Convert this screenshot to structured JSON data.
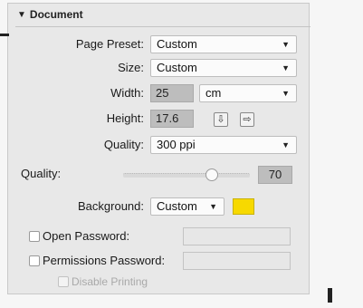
{
  "document": {
    "section_title": "Document",
    "page_preset": {
      "label": "Page Preset:",
      "value": "Custom"
    },
    "size": {
      "label": "Size:",
      "value": "Custom"
    },
    "width": {
      "label": "Width:",
      "value": "25",
      "unit": "cm"
    },
    "height": {
      "label": "Height:",
      "value": "17.6"
    },
    "quality_select": {
      "label": "Quality:",
      "value": "300 ppi"
    },
    "quality_slider": {
      "label": "Quality:",
      "value": "70",
      "level": 0.7
    },
    "background": {
      "label": "Background:",
      "value": "Custom",
      "swatch_color": "#f7d900"
    },
    "open_password": {
      "label": "Open Password:",
      "value": ""
    },
    "permissions_password": {
      "label": "Permissions Password:",
      "value": ""
    },
    "disable_printing": {
      "label": "Disable Printing"
    }
  },
  "icons": {
    "section_toggle": "disclosure-triangle-icon",
    "dropdown": "chevron-down-icon",
    "portrait": "portrait-orientation-icon",
    "landscape": "landscape-orientation-icon"
  },
  "colors": {
    "panel_bg": "#e8e8e8",
    "field_bg": "#bdbdbd",
    "swatch": "#f7d900"
  }
}
